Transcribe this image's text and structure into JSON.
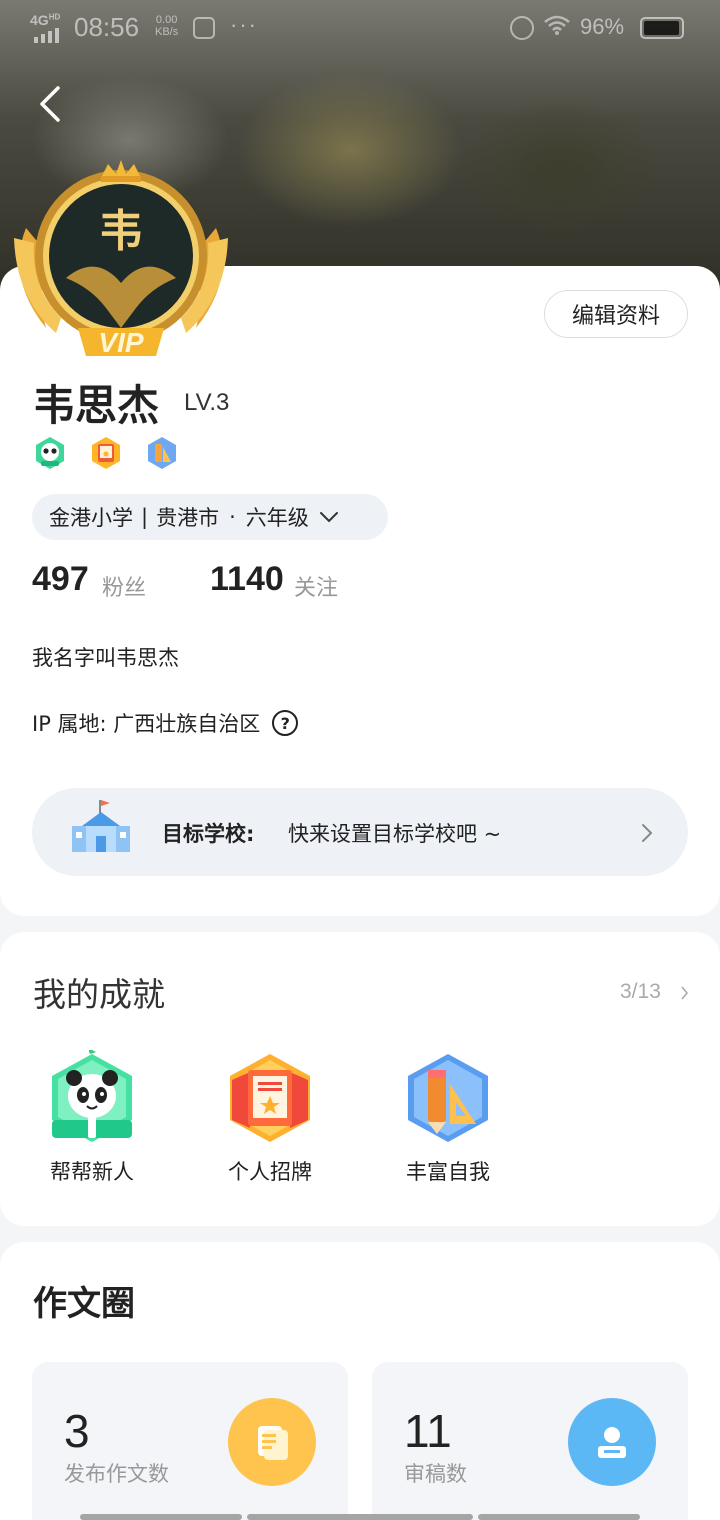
{
  "status_bar": {
    "network": "4G",
    "network_sup": "HD",
    "time": "08:56",
    "speed_value": "0.00",
    "speed_unit": "KB/s",
    "more": "···",
    "battery": "96%"
  },
  "profile": {
    "edit_label": "编辑资料",
    "name": "韦思杰",
    "level": "LV.3",
    "avatar_char": "韦",
    "vip_text": "VIP",
    "school": "金港小学",
    "city": "贵港市",
    "grade": "六年级",
    "followers_count": "497",
    "followers_label": "粉丝",
    "following_count": "1140",
    "following_label": "关注",
    "bio": "我名字叫韦思杰",
    "ip_label": "IP 属地: 广西壮族自治区",
    "ip_help": "?",
    "target_label": "目标学校:",
    "target_text": "快来设置目标学校吧 ~"
  },
  "achievements": {
    "title": "我的成就",
    "count": "3/13",
    "items": [
      {
        "label": "帮帮新人",
        "icon": "panda-badge-icon"
      },
      {
        "label": "个人招牌",
        "icon": "signboard-badge-icon"
      },
      {
        "label": "丰富自我",
        "icon": "pencil-ruler-badge-icon"
      }
    ]
  },
  "essay_circle": {
    "title": "作文圈",
    "stats": [
      {
        "value": "3",
        "label": "发布作文数",
        "icon": "document-icon",
        "color": "#ffc44d"
      },
      {
        "value": "11",
        "label": "审稿数",
        "icon": "reviewer-icon",
        "color": "#5cb8f5"
      }
    ]
  },
  "colors": {
    "pill_bg": "#eef2f6",
    "muted_text": "#999999",
    "gold": "#e8b13a"
  }
}
